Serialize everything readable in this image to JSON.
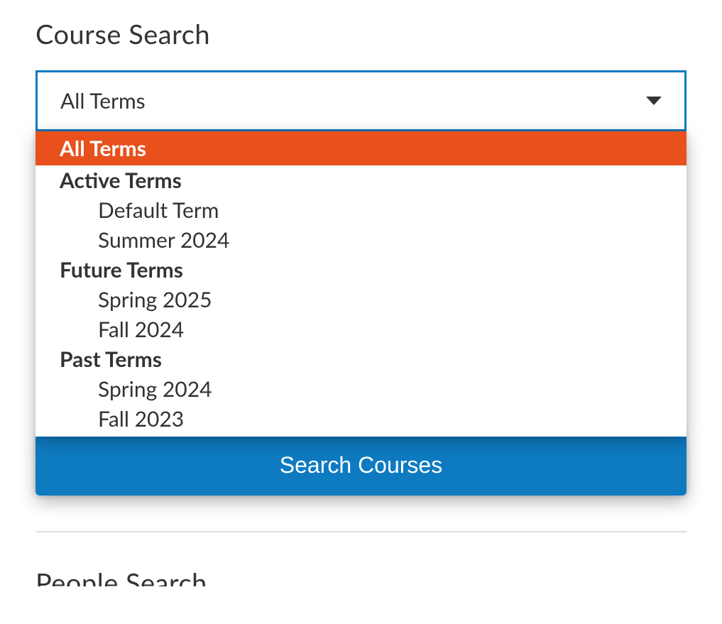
{
  "course_search": {
    "heading": "Course Search",
    "select_value": "All Terms",
    "search_button": "Search Courses",
    "dropdown": {
      "selected": "All Terms",
      "groups": [
        {
          "label": "Active Terms",
          "items": [
            "Default Term",
            "Summer 2024"
          ]
        },
        {
          "label": "Future Terms",
          "items": [
            "Spring 2025",
            "Fall 2024"
          ]
        },
        {
          "label": "Past Terms",
          "items": [
            "Spring 2024",
            "Fall 2023"
          ]
        }
      ]
    }
  },
  "people_search": {
    "heading": "People Search"
  }
}
